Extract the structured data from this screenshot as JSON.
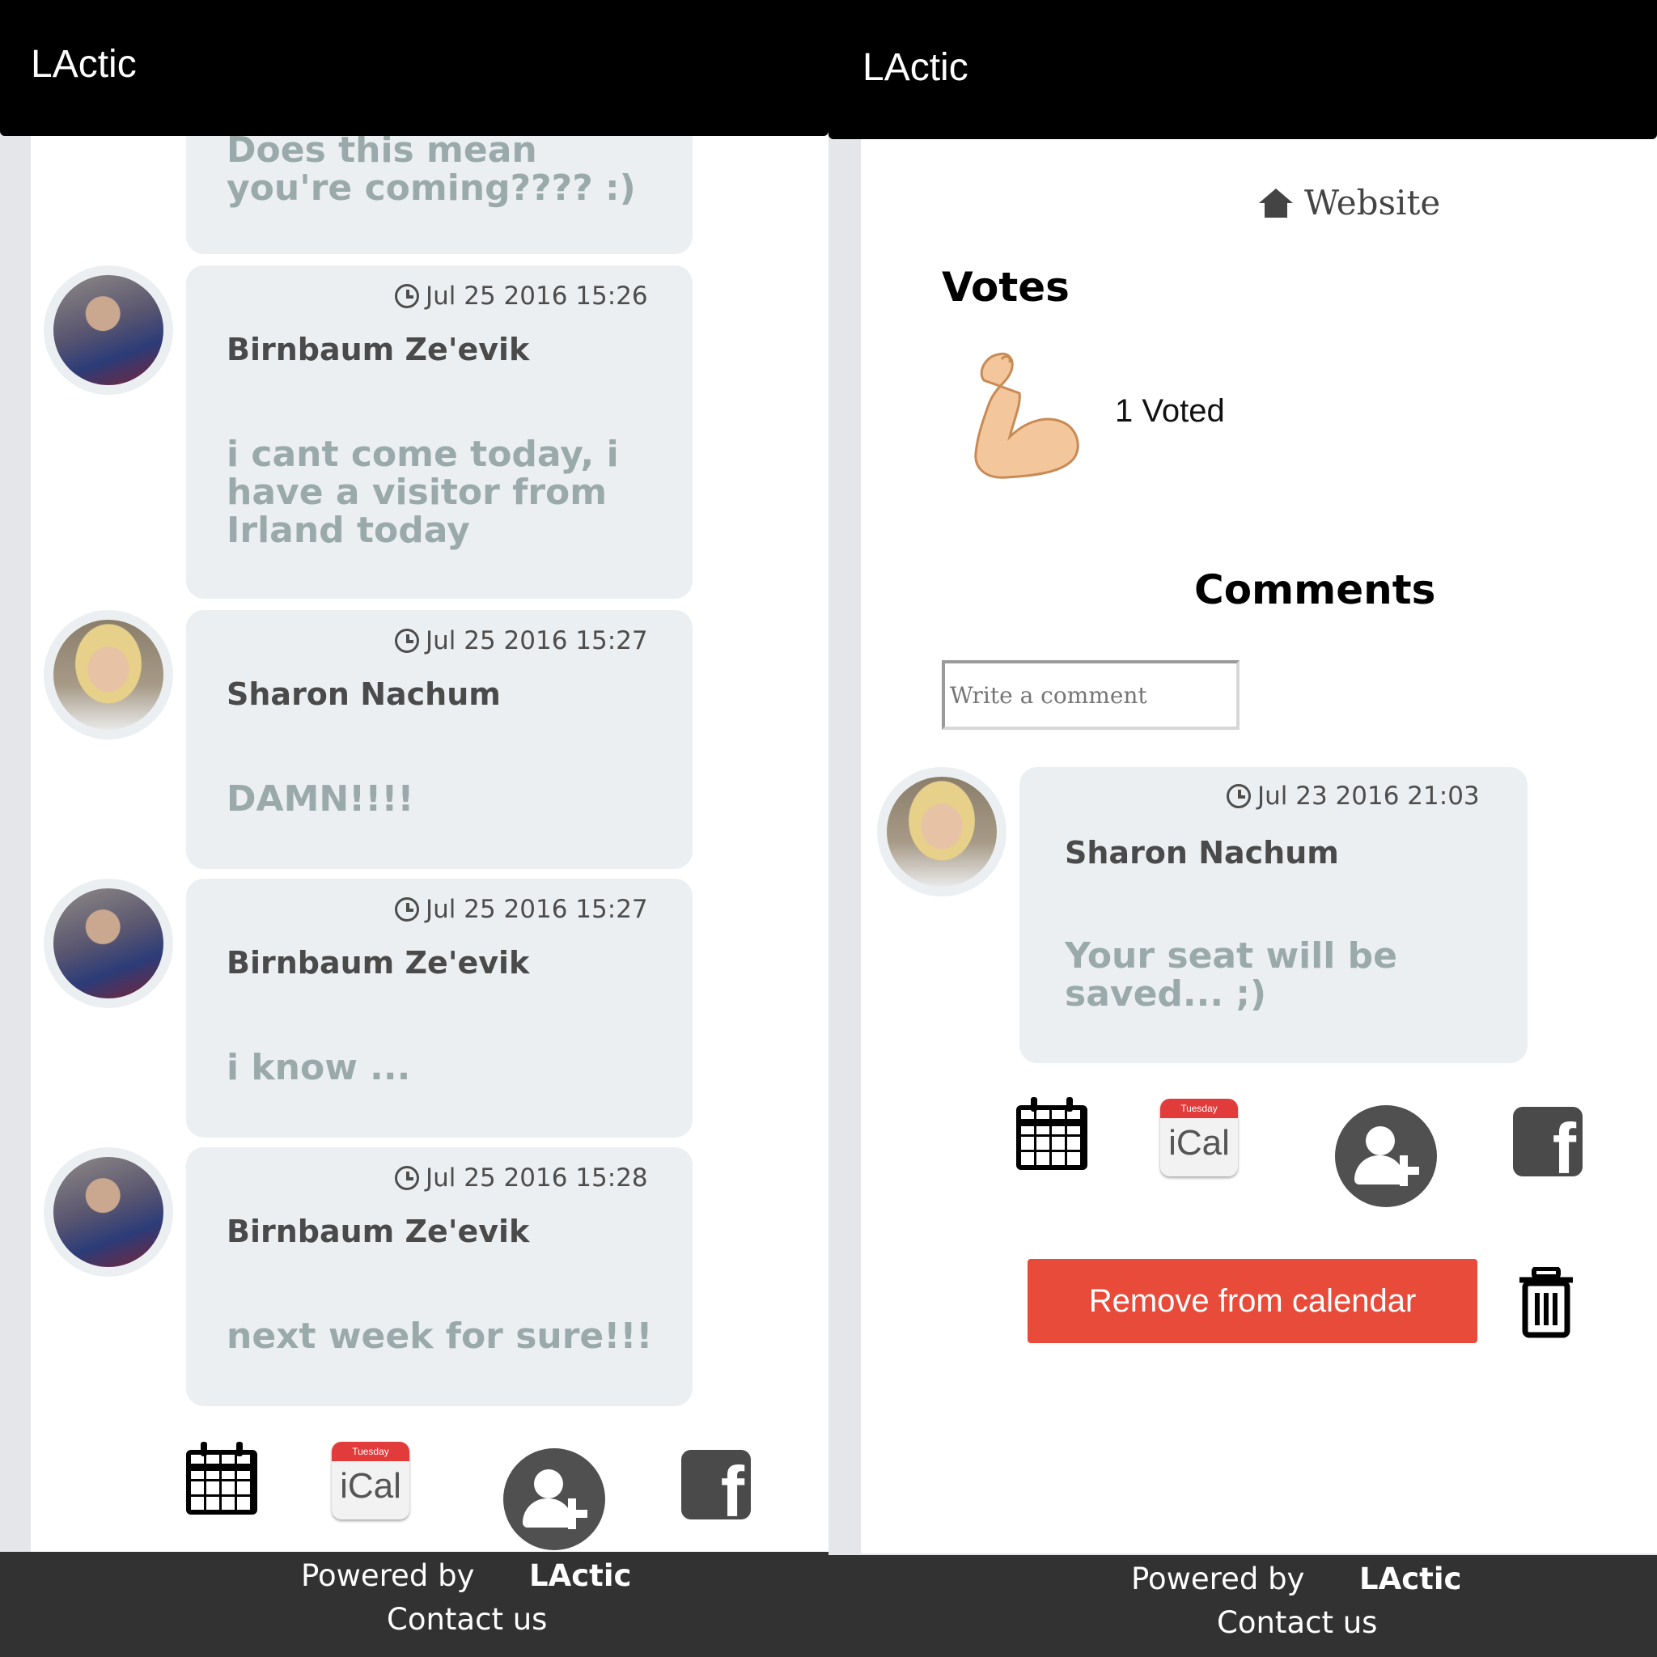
{
  "app_title": "LActic",
  "left_comments": [
    {
      "timestamp": "",
      "author": "",
      "message": "Does this mean you're coming???? :)"
    },
    {
      "timestamp": "Jul 25 2016 15:26",
      "author": "Birnbaum Ze'evik",
      "message": "i cant come today, i have a visitor from Irland today"
    },
    {
      "timestamp": "Jul 25 2016 15:27",
      "author": "Sharon Nachum",
      "message": "DAMN!!!!"
    },
    {
      "timestamp": "Jul 25 2016 15:27",
      "author": "Birnbaum Ze'evik",
      "message": "i know ..."
    },
    {
      "timestamp": "Jul 25 2016 15:28",
      "author": "Birnbaum Ze'evik",
      "message": "next week for sure!!!"
    }
  ],
  "actions": {
    "ical_label": "iCal",
    "ical_band": "Tuesday",
    "facebook_glyph": "f",
    "icons": [
      "calendar-icon",
      "ical-icon",
      "add-user-icon",
      "facebook-icon",
      "trash-icon",
      "clock-icon",
      "home-icon",
      "flexed-biceps-icon"
    ]
  },
  "footer": {
    "powered_by": "Powered by",
    "brand": "LActic",
    "contact": "Contact us"
  },
  "right": {
    "website_label": "Website",
    "votes_heading": "Votes",
    "voted_text": "1 Voted",
    "comments_heading": "Comments",
    "comment_placeholder": "Write a comment",
    "comment": {
      "timestamp": "Jul 23 2016 21:03",
      "author": "Sharon Nachum",
      "message": "Your seat will be saved... ;)"
    },
    "remove_button": "Remove from calendar"
  },
  "colors": {
    "accent_red": "#e84b3a",
    "card_bg": "#eceff1",
    "message_text": "#9aaaaa",
    "footer_bg": "#323232"
  }
}
